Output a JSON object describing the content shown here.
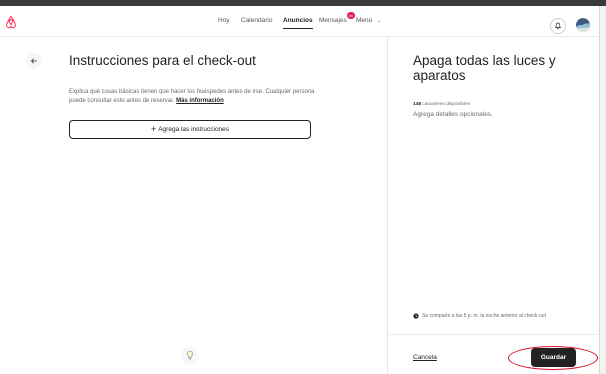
{
  "header": {
    "nav": [
      {
        "label": "Hoy"
      },
      {
        "label": "Calendario"
      },
      {
        "label": "Anuncios"
      },
      {
        "label": "Mensajes"
      },
      {
        "label": "Menú"
      }
    ]
  },
  "left": {
    "title": "Instrucciones para el check-out",
    "description": "Explica qué cosas básicas tienen que hacer los huéspedes antes de irse. Cualquier persona puede consultar esto antes de reservar.",
    "more_link": "Más información",
    "add_button": "Agrega las instrucciones"
  },
  "right": {
    "title": "Apaga todas las luces y aparatos",
    "chars_count": "148",
    "chars_label": "caracteres disponibles",
    "placeholder": "Agrega detalles opcionales.",
    "note": "Se comparte a las 5 p. m. la noche anterior al check-out",
    "cancel_label": "Cancela",
    "save_label": "Guardar"
  },
  "colors": {
    "brand": "#ff385c",
    "badge": "#e31c5f",
    "primary_button": "#222222",
    "annotation_ring": "#d8102a"
  },
  "icons": [
    "airbnb-logo-icon",
    "bell-icon",
    "avatar",
    "arrow-left-icon",
    "plus-icon",
    "lightbulb-icon",
    "clock-icon",
    "chevron-down-icon"
  ]
}
